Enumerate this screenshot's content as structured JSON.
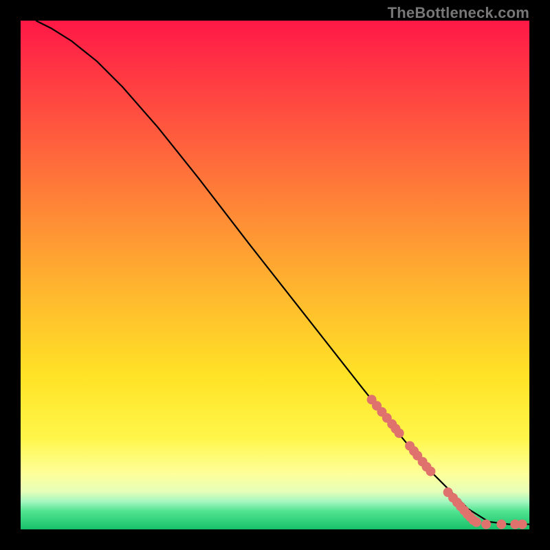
{
  "watermark": "TheBottleneck.com",
  "chart_data": {
    "type": "line",
    "title": "",
    "xlabel": "",
    "ylabel": "",
    "xlim": [
      0,
      100
    ],
    "ylim": [
      0,
      100
    ],
    "grid": false,
    "series": [
      {
        "name": "curve",
        "x": [
          3,
          6,
          10,
          15,
          20,
          27,
          35,
          45,
          56,
          67,
          75,
          80,
          84,
          88,
          92,
          96,
          100
        ],
        "y": [
          100,
          98.5,
          96,
          92,
          87,
          79,
          69,
          56,
          42,
          28,
          18,
          12,
          8,
          4,
          1.5,
          1,
          1
        ]
      }
    ],
    "points": {
      "name": "markers",
      "color": "#e0726d",
      "x": [
        69,
        70,
        71,
        72,
        73,
        73.7,
        74.4,
        76.5,
        77.3,
        78,
        79,
        79.8,
        80.6,
        84,
        85,
        85.8,
        86.5,
        87.2,
        87.8,
        88.4,
        89,
        89.6,
        91.5,
        94.5,
        97.2,
        98.6
      ],
      "y": [
        25.5,
        24.3,
        23.1,
        21.9,
        20.7,
        19.8,
        18.9,
        16.4,
        15.4,
        14.5,
        13.3,
        12.3,
        11.4,
        7.3,
        6.2,
        5.3,
        4.5,
        3.7,
        3.0,
        2.4,
        1.8,
        1.4,
        1.0,
        1.0,
        1.0,
        1.0
      ]
    }
  }
}
